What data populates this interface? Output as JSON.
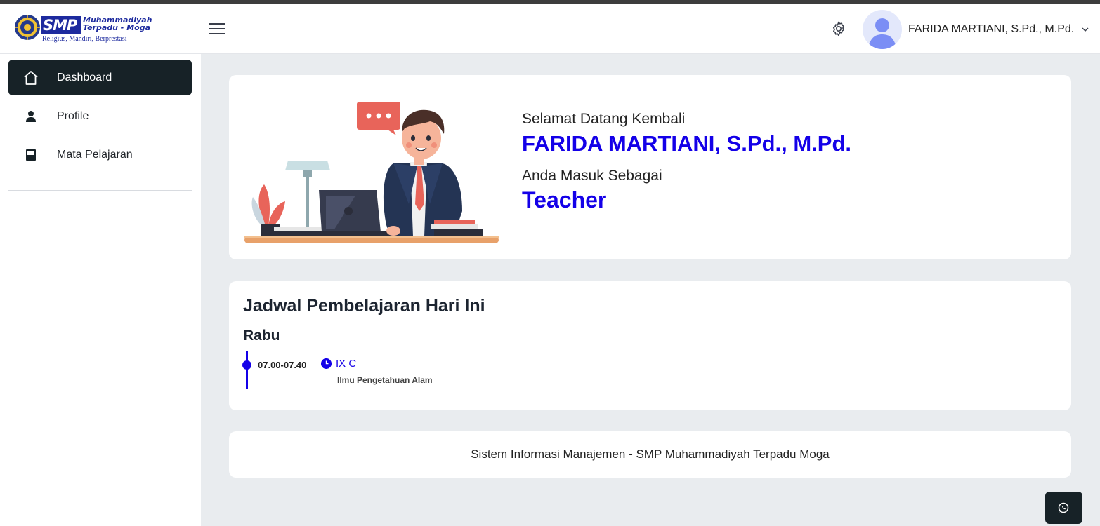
{
  "header": {
    "logo_text": "SMP",
    "logo_subtext": "Muhammadiyah\nTerpadu - Moga",
    "logo_tagline": "Religius, Mandiri, Berprestasi",
    "user_name": "FARIDA MARTIANI, S.Pd., M.Pd."
  },
  "sidebar": {
    "items": [
      {
        "label": "Dashboard",
        "icon": "home-icon",
        "active": true
      },
      {
        "label": "Profile",
        "icon": "user-icon"
      },
      {
        "label": "Mata Pelajaran",
        "icon": "book-icon"
      }
    ]
  },
  "welcome": {
    "greeting": "Selamat Datang Kembali",
    "name": "FARIDA MARTIANI, S.Pd., M.Pd.",
    "role_label": "Anda Masuk Sebagai",
    "role": "Teacher"
  },
  "schedule": {
    "title": "Jadwal Pembelajaran Hari Ini",
    "day": "Rabu",
    "entries": [
      {
        "time": "07.00-07.40",
        "class": "IX C",
        "subject": "Ilmu Pengetahuan Alam"
      }
    ]
  },
  "footer": {
    "text": "Sistem Informasi Manajemen - SMP Muhammadiyah Terpadu Moga"
  },
  "colors": {
    "accent": "#1400e8",
    "sidebar_active": "#172227",
    "background": "#e9ecef"
  },
  "icons": {
    "menu": "hamburger-icon",
    "settings": "gear-icon",
    "caret": "chevron-down-icon",
    "whatsapp": "whatsapp-icon",
    "clock": "clock-icon"
  }
}
